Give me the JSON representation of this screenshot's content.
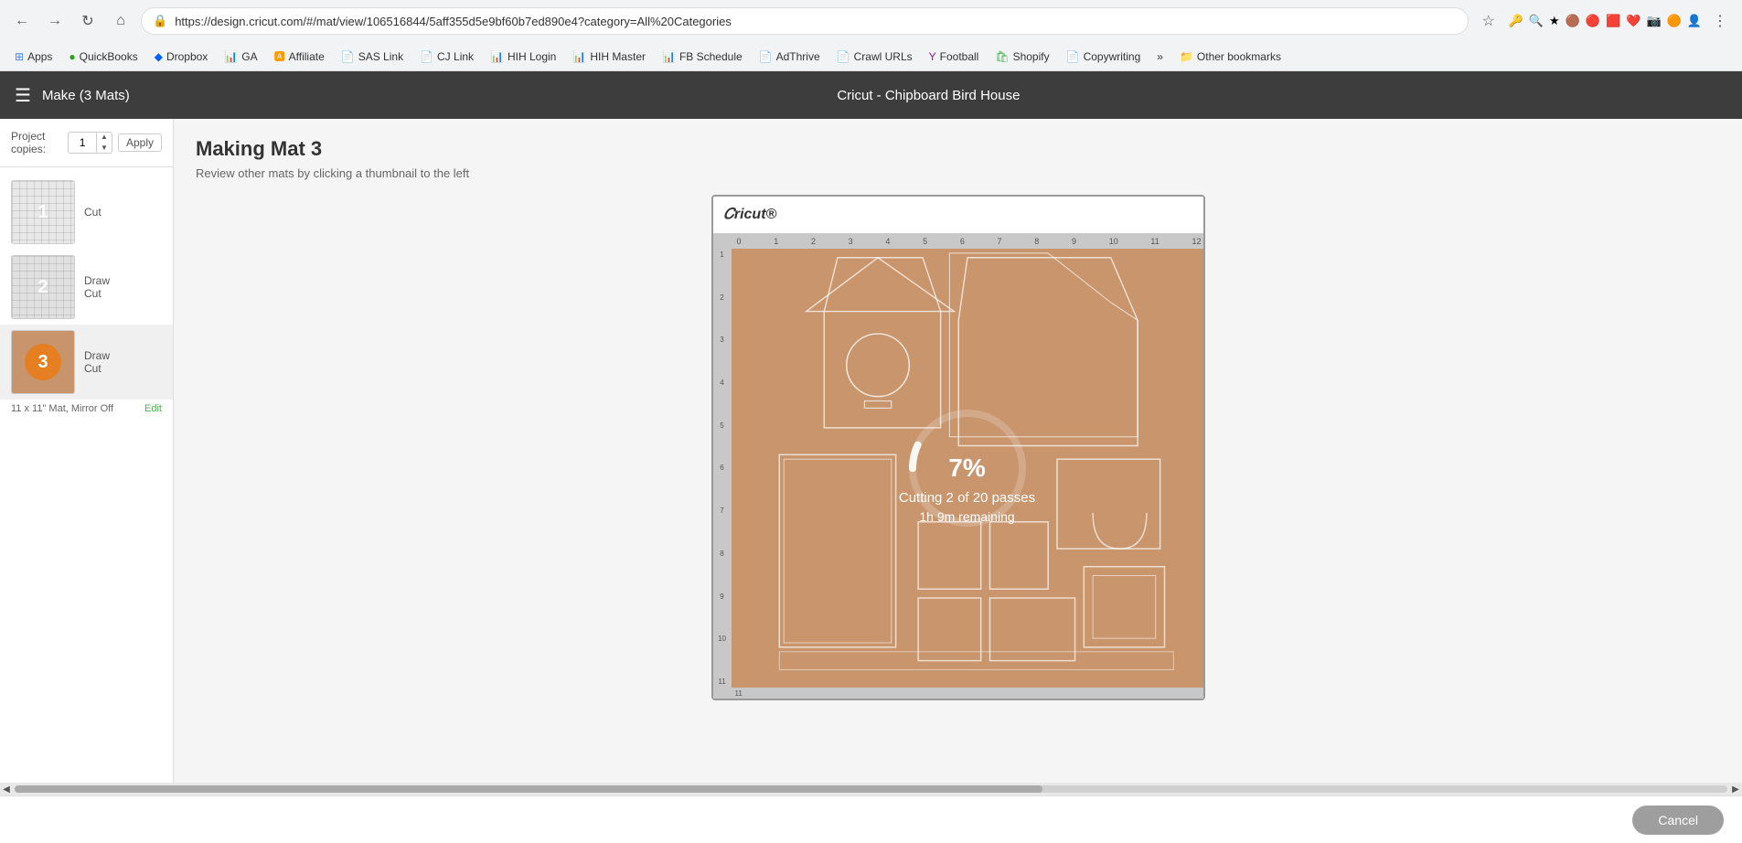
{
  "browser": {
    "url": "https://design.cricut.com/#/mat/view/106516844/5aff355d5e9bf60b7ed890e4?category=All%20Categories",
    "back_tooltip": "Back",
    "forward_tooltip": "Forward",
    "reload_tooltip": "Reload",
    "bookmarks": [
      {
        "label": "Apps",
        "icon_color": "#4285f4"
      },
      {
        "label": "QuickBooks",
        "icon_color": "#2ca01c"
      },
      {
        "label": "Dropbox",
        "icon_color": "#0061ff"
      },
      {
        "label": "GA",
        "icon_color": "#f57c00"
      },
      {
        "label": "Affiliate",
        "icon_color": "#ff9900"
      },
      {
        "label": "SAS Link",
        "icon_color": "#888"
      },
      {
        "label": "CJ Link",
        "icon_color": "#888"
      },
      {
        "label": "HIH Login",
        "icon_color": "#2e7d32"
      },
      {
        "label": "HIH Master",
        "icon_color": "#388e3c"
      },
      {
        "label": "FB Schedule",
        "icon_color": "#388e3c"
      },
      {
        "label": "AdThrive",
        "icon_color": "#888"
      },
      {
        "label": "Crawl URLs",
        "icon_color": "#888"
      },
      {
        "label": "Football",
        "icon_color": "#7b1fa2"
      },
      {
        "label": "Shopify",
        "icon_color": "#4caf50"
      },
      {
        "label": "Copywriting",
        "icon_color": "#888"
      },
      {
        "label": "»",
        "icon_color": "#888"
      },
      {
        "label": "Other bookmarks",
        "icon_color": "#f9a825"
      }
    ]
  },
  "app": {
    "menu_icon": "☰",
    "header_title": "Make (3 Mats)",
    "center_title": "Cricut - Chipboard Bird House"
  },
  "sidebar": {
    "project_copies_label": "Project copies:",
    "copies_value": "",
    "apply_label": "Apply",
    "mats": [
      {
        "number": "1",
        "label_line1": "Cut",
        "label_line2": ""
      },
      {
        "number": "2",
        "label_line1": "Draw",
        "label_line2": "Cut"
      },
      {
        "number": "3",
        "label_line1": "Draw",
        "label_line2": "Cut"
      }
    ],
    "mat_info": "11 x 11\" Mat, Mirror Off",
    "edit_label": "Edit"
  },
  "main": {
    "title": "Making Mat 3",
    "subtitle": "Review other mats by clicking a thumbnail to the left",
    "mat_size": "11 x 11\" Mat, Mirror Off",
    "ruler_numbers": [
      "0",
      "1",
      "2",
      "3",
      "4",
      "5",
      "6",
      "7",
      "8",
      "9",
      "10",
      "11",
      "12"
    ],
    "ruler_left_numbers": [
      "1",
      "2",
      "3",
      "4",
      "5",
      "6",
      "7",
      "8",
      "9",
      "10",
      "11"
    ],
    "progress": {
      "percent": "7%",
      "status_line1": "Cutting 2 of 20 passes",
      "status_line2": "1h 9m remaining"
    }
  },
  "footer": {
    "cancel_label": "Cancel"
  }
}
